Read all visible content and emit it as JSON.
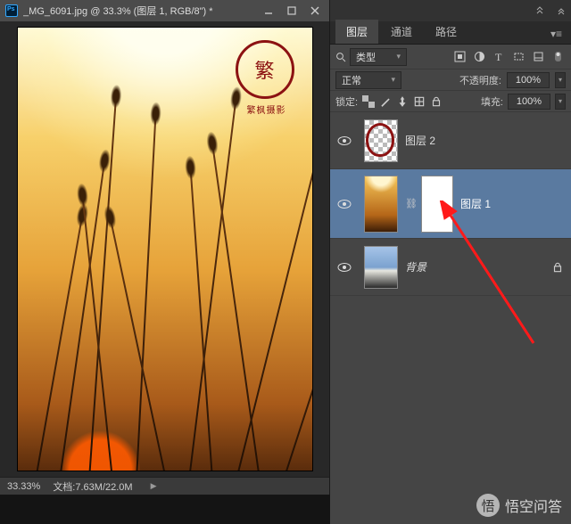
{
  "title": "_MG_6091.jpg @ 33.3% (图层 1, RGB/8\") *",
  "status": {
    "zoom": "33.33%",
    "doc_label": "文档:",
    "doc_value": "7.63M/22.0M"
  },
  "tabs": {
    "layers": "图层",
    "channels": "通道",
    "paths": "路径"
  },
  "filter": {
    "kind": "类型"
  },
  "blend": {
    "mode": "正常",
    "opacity_label": "不透明度:",
    "opacity": "100%"
  },
  "lock": {
    "label": "锁定:",
    "fill_label": "填充:",
    "fill": "100%"
  },
  "layers_list": [
    {
      "name": "图层 2"
    },
    {
      "name": "图层 1"
    },
    {
      "name": "背景"
    }
  ],
  "watermark": "悟空问答"
}
